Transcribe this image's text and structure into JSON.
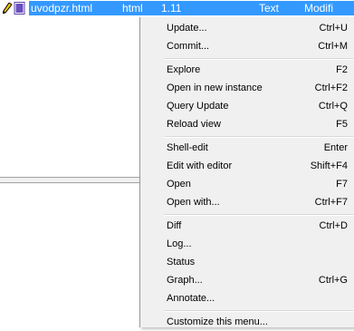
{
  "file": {
    "name": "uvodpzr.html",
    "type": "html",
    "revision": "1.11",
    "status": "Text",
    "modified": "Modifi"
  },
  "menu": {
    "items": [
      {
        "label": "Update...",
        "shortcut": "Ctrl+U"
      },
      {
        "label": "Commit...",
        "shortcut": "Ctrl+M"
      },
      {
        "label": "Explore",
        "shortcut": "F2"
      },
      {
        "label": "Open in new instance",
        "shortcut": "Ctrl+F2"
      },
      {
        "label": "Query Update",
        "shortcut": "Ctrl+Q"
      },
      {
        "label": "Reload view",
        "shortcut": "F5"
      },
      {
        "label": "Shell-edit",
        "shortcut": "Enter"
      },
      {
        "label": "Edit with editor",
        "shortcut": "Shift+F4"
      },
      {
        "label": "Open",
        "shortcut": "F7"
      },
      {
        "label": "Open with...",
        "shortcut": "Ctrl+F7"
      },
      {
        "label": "Diff",
        "shortcut": "Ctrl+D"
      },
      {
        "label": "Log...",
        "shortcut": ""
      },
      {
        "label": "Status",
        "shortcut": ""
      },
      {
        "label": "Graph...",
        "shortcut": "Ctrl+G"
      },
      {
        "label": "Annotate...",
        "shortcut": ""
      },
      {
        "label": "Customize this menu...",
        "shortcut": ""
      }
    ]
  },
  "icons": {
    "row_icons": [
      "pencil-icon",
      "html-file-icon"
    ]
  },
  "colors": {
    "selection": "#3399ff",
    "menu_bg": "#f0f0f0"
  }
}
